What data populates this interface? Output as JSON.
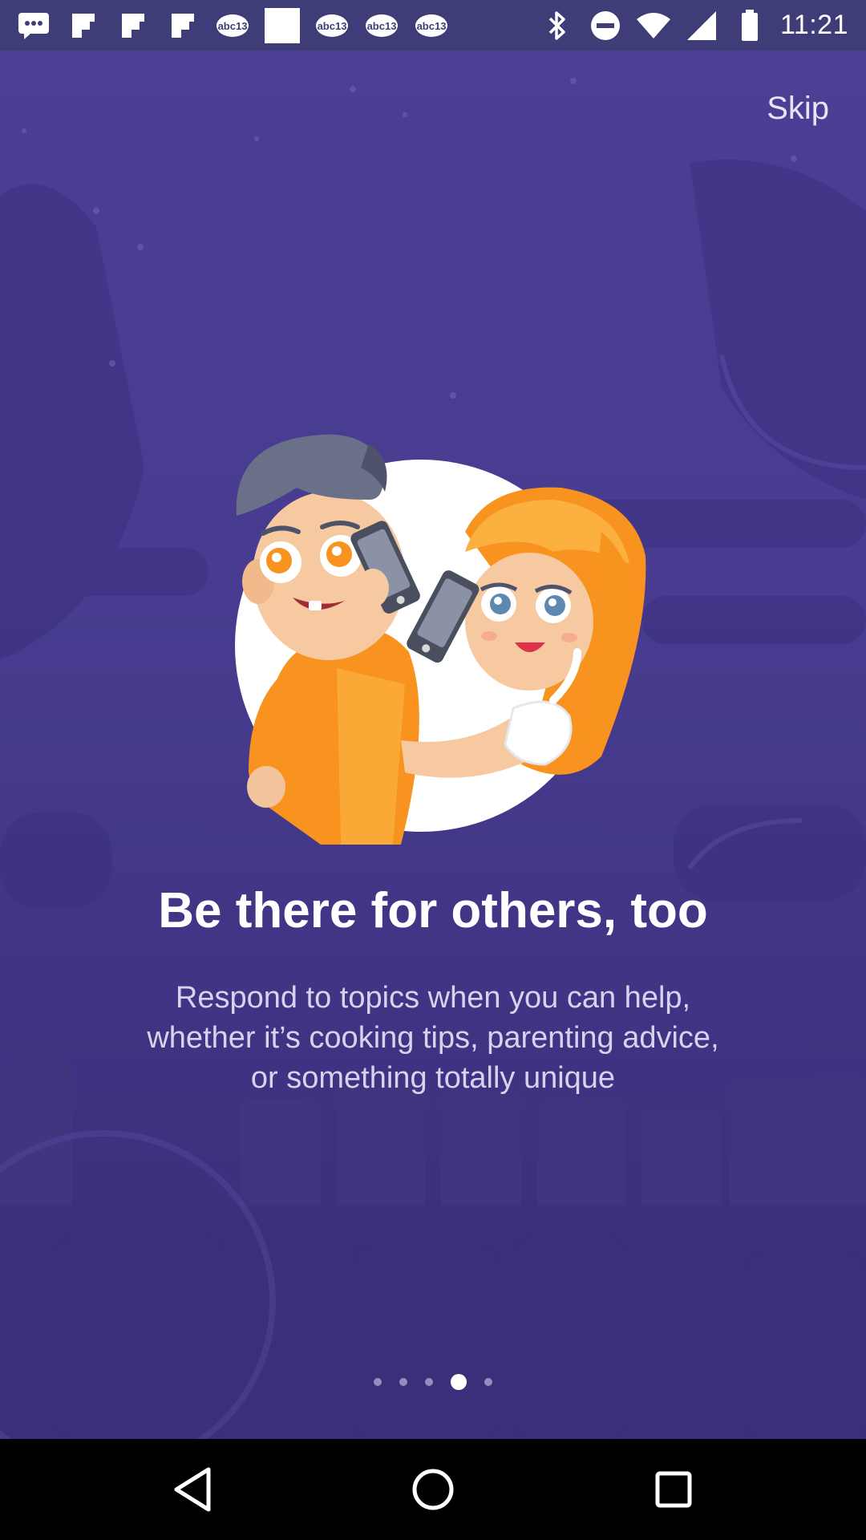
{
  "status_bar": {
    "time": "11:21",
    "left_icons": [
      "messages-icon",
      "flipboard-icon",
      "flipboard-icon",
      "flipboard-icon",
      "abc13-icon",
      "image-icon",
      "abc13-icon",
      "abc13-icon",
      "abc13-icon"
    ],
    "right_icons": [
      "bluetooth-icon",
      "do-not-disturb-icon",
      "wifi-icon",
      "signal-icon",
      "battery-icon"
    ]
  },
  "onboarding": {
    "skip_label": "Skip",
    "headline": "Be there for others, too",
    "subtitle_lines": [
      "Respond to topics when you can help,",
      "whether it’s cooking tips, parenting advice,",
      "or something totally unique"
    ],
    "pager": {
      "total": 5,
      "active_index": 3
    },
    "illustration": "two-people-talking-on-phones"
  },
  "nav_bar": {
    "buttons": [
      "back-icon",
      "home-icon",
      "recents-icon"
    ]
  },
  "colors": {
    "status_bar_bg": "#3f3d77",
    "background_top": "#4b3f95",
    "background_bottom": "#382c78",
    "headline": "#ffffff",
    "subtitle": "#d7d3ee",
    "accent_orange": "#f7931e"
  }
}
